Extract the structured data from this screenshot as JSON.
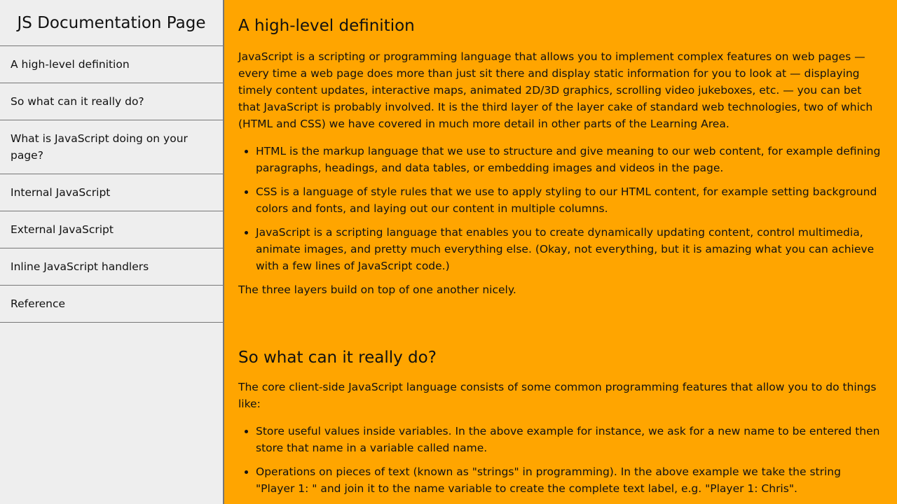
{
  "navbar": {
    "title": "JS Documentation Page",
    "items": [
      {
        "label": "A high-level definition"
      },
      {
        "label": "So what can it really do?"
      },
      {
        "label": "What is JavaScript doing on your page?"
      },
      {
        "label": "Internal JavaScript"
      },
      {
        "label": "External JavaScript"
      },
      {
        "label": "Inline JavaScript handlers"
      },
      {
        "label": "Reference"
      }
    ]
  },
  "main": {
    "sections": [
      {
        "title": "A high-level definition",
        "paragraph1": "JavaScript is a scripting or programming language that allows you to implement complex features on web pages — every time a web page does more than just sit there and display static information for you to look at — displaying timely content updates, interactive maps, animated 2D/3D graphics, scrolling video jukeboxes, etc. — you can bet that JavaScript is probably involved. It is the third layer of the layer cake of standard web technologies, two of which (HTML and CSS) we have covered in much more detail in other parts of the Learning Area.",
        "list": [
          "HTML is the markup language that we use to structure and give meaning to our web content, for example defining paragraphs, headings, and data tables, or embedding images and videos in the page.",
          "CSS is a language of style rules that we use to apply styling to our HTML content, for example setting background colors and fonts, and laying out our content in multiple columns.",
          "JavaScript is a scripting language that enables you to create dynamically updating content, control multimedia, animate images, and pretty much everything else. (Okay, not everything, but it is amazing what you can achieve with a few lines of JavaScript code.)"
        ],
        "paragraph2": "The three layers build on top of one another nicely."
      },
      {
        "title": "So what can it really do?",
        "paragraph1": "The core client-side JavaScript language consists of some common programming features that allow you to do things like:",
        "list": [
          "Store useful values inside variables. In the above example for instance, we ask for a new name to be entered then store that name in a variable called name.",
          "Operations on pieces of text (known as \"strings\" in programming). In the above example we take the string \"Player 1: \" and join it to the name variable to create the complete text label, e.g. \"Player 1: Chris\"."
        ]
      }
    ]
  },
  "colors": {
    "sidebar_bg": "#eeeeee",
    "main_bg": "#ffa500",
    "border": "#777777"
  }
}
